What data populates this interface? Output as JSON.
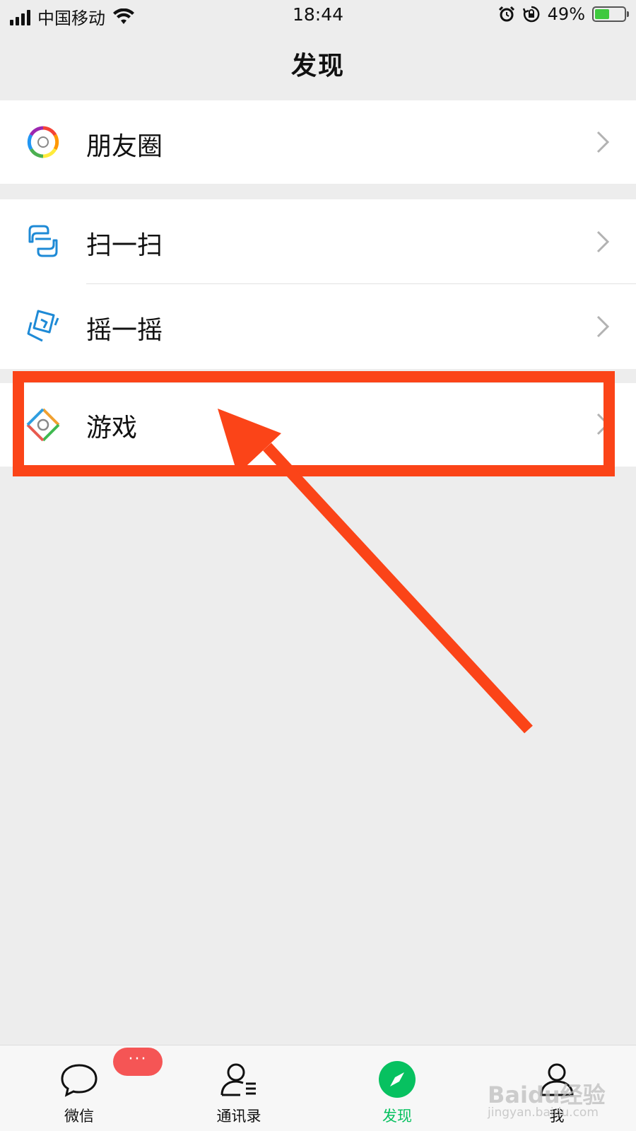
{
  "status_bar": {
    "carrier": "中国移动",
    "time": "18:44",
    "battery_percent": "49%",
    "battery_level": 0.49,
    "icons": [
      "signal-icon",
      "wifi-icon",
      "alarm-icon",
      "rotation-lock-icon",
      "battery-charging-icon"
    ]
  },
  "nav": {
    "title": "发现"
  },
  "list": {
    "moments": {
      "label": "朋友圈",
      "icon": "moments-icon"
    },
    "scan": {
      "label": "扫一扫",
      "icon": "scan-icon"
    },
    "shake": {
      "label": "摇一摇",
      "icon": "shake-icon"
    },
    "games": {
      "label": "游戏",
      "icon": "games-icon"
    }
  },
  "annotation": {
    "color": "#fb4418",
    "highlighted_item": "games"
  },
  "tab_bar": {
    "tabs": [
      {
        "label": "微信",
        "icon": "chat-icon",
        "active": false
      },
      {
        "label": "通讯录",
        "icon": "contacts-icon",
        "active": false
      },
      {
        "label": "发现",
        "icon": "discover-compass-icon",
        "active": true
      },
      {
        "label": "我",
        "icon": "me-icon",
        "active": false
      }
    ],
    "badge": "···",
    "active_color": "#07c160"
  },
  "watermark": {
    "line1": "Baidu经验",
    "line2": "jingyan.baidu.com"
  }
}
